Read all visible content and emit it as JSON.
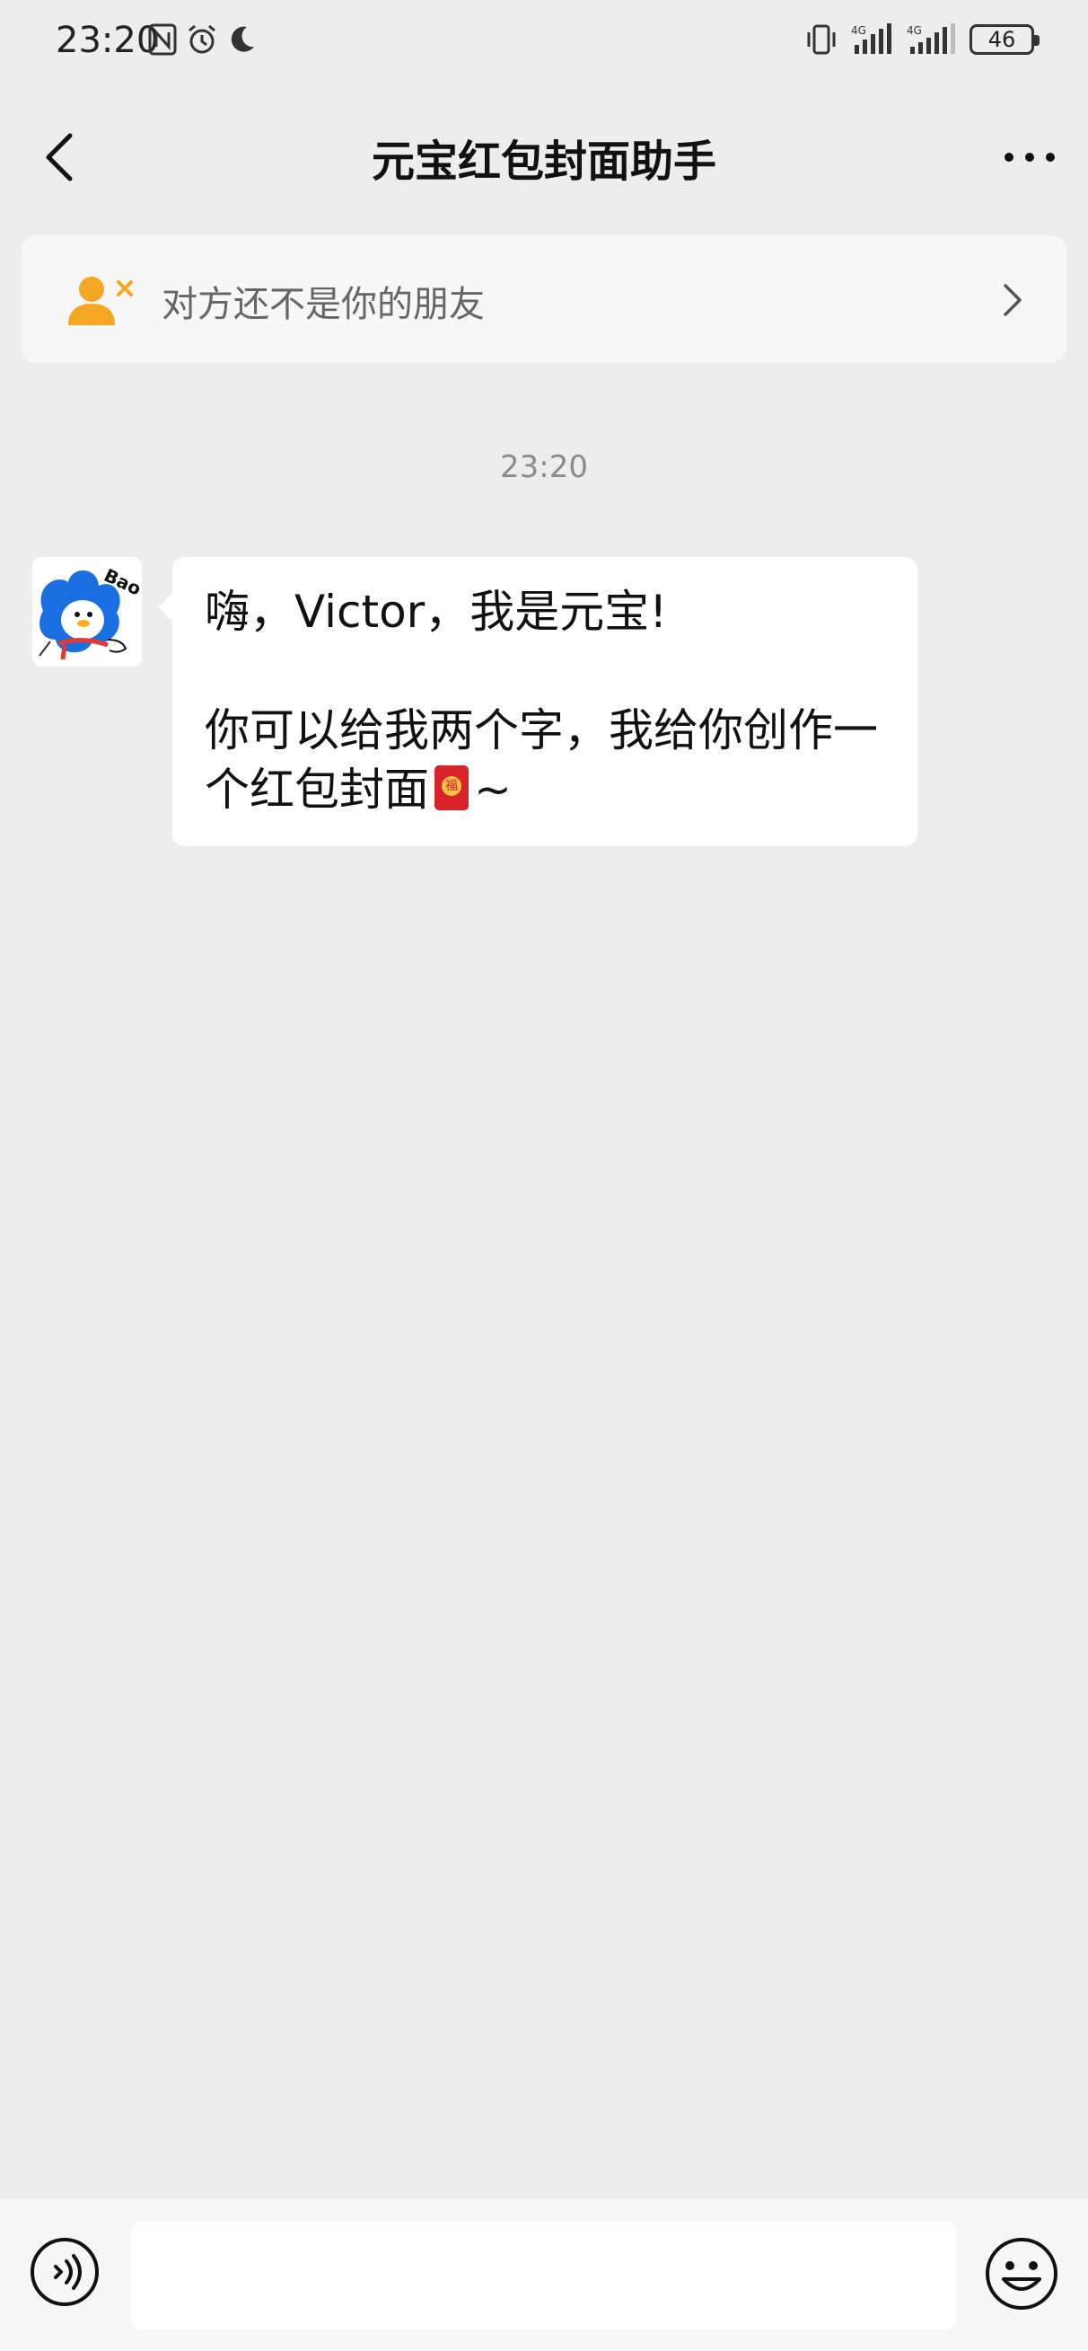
{
  "status_bar": {
    "time": "23:20",
    "battery": "46"
  },
  "header": {
    "title": "元宝红包封面助手"
  },
  "friend_notice": {
    "text": "对方还不是你的朋友"
  },
  "chat": {
    "timestamp": "23:20",
    "messages": [
      {
        "sender_avatar_text": "Bao",
        "line1": "嗨，Victor，我是元宝!",
        "line2": "你可以给我两个字，我给你创作一个红包封面",
        "line2_suffix": "~"
      }
    ]
  },
  "input": {
    "placeholder": ""
  },
  "colors": {
    "background": "#ededed",
    "accent_orange": "#f5a623",
    "avatar_blue": "#1a6fe0"
  },
  "icons": {
    "back": "chevron-left-icon",
    "more": "more-dots-icon",
    "add_friend": "user-x-icon",
    "notice_arrow": "chevron-right-icon",
    "voice": "voice-icon",
    "emoji": "emoji-icon"
  }
}
